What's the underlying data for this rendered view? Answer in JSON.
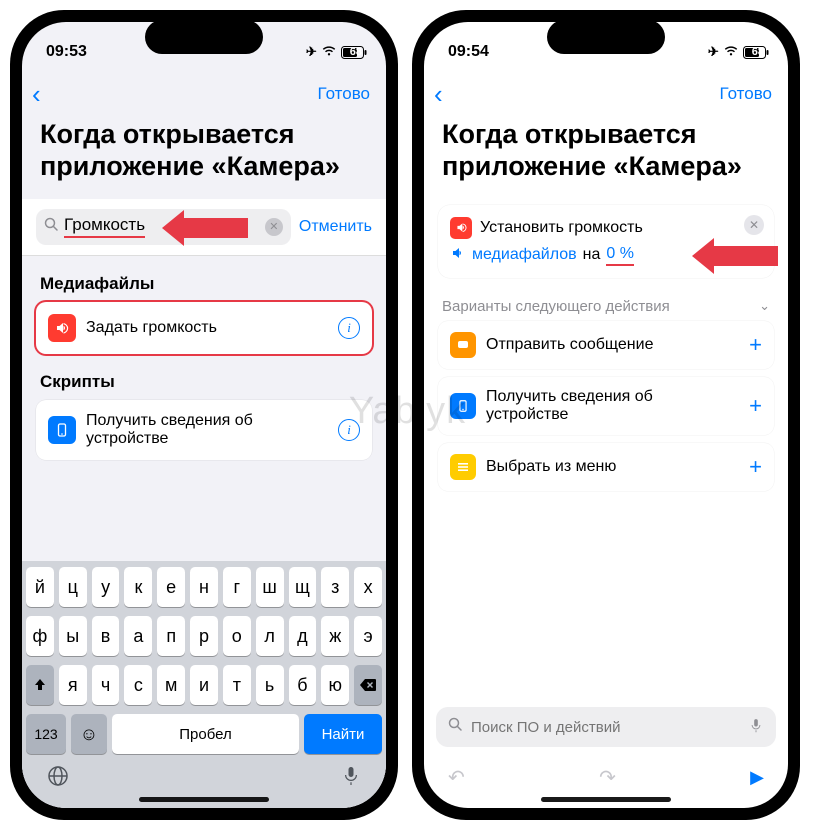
{
  "watermark": "Yablyk",
  "left": {
    "status": {
      "time": "09:53",
      "battery": "68"
    },
    "nav": {
      "done": "Готово"
    },
    "title": "Когда открывается приложение «Камера»",
    "search": {
      "value": "Громкость",
      "cancel": "Отменить"
    },
    "sections": {
      "media": {
        "label": "Медиафайлы",
        "item": "Задать громкость"
      },
      "scripts": {
        "label": "Скрипты",
        "item": "Получить сведения об устройстве"
      }
    },
    "keyboard": {
      "row1": [
        "й",
        "ц",
        "у",
        "к",
        "е",
        "н",
        "г",
        "ш",
        "щ",
        "з",
        "х"
      ],
      "row2": [
        "ф",
        "ы",
        "в",
        "а",
        "п",
        "р",
        "о",
        "л",
        "д",
        "ж",
        "э"
      ],
      "row3": [
        "я",
        "ч",
        "с",
        "м",
        "и",
        "т",
        "ь",
        "б",
        "ю"
      ],
      "numbers": "123",
      "space": "Пробел",
      "search": "Найти"
    }
  },
  "right": {
    "status": {
      "time": "09:54",
      "battery": "68"
    },
    "nav": {
      "done": "Готово"
    },
    "title": "Когда открывается приложение «Камера»",
    "workflow": {
      "action": "Установить громкость",
      "media": "медиафайлов",
      "on": "на",
      "value": "0 %"
    },
    "suggestions": {
      "header": "Варианты следующего действия",
      "items": [
        "Отправить сообщение",
        "Получить сведения об устройстве",
        "Выбрать из меню"
      ]
    },
    "search_placeholder": "Поиск ПО и действий"
  }
}
